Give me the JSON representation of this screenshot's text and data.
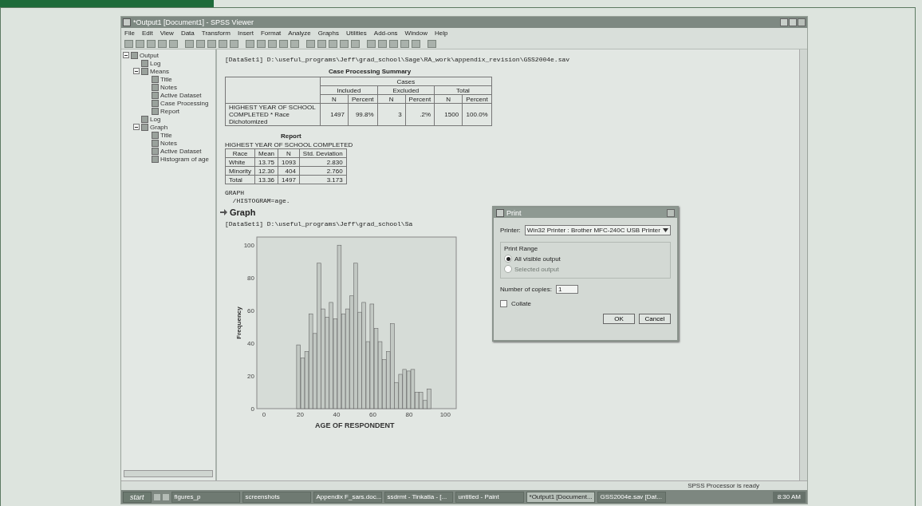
{
  "window": {
    "title": "*Output1 [Document1] - SPSS Viewer"
  },
  "menu": [
    "File",
    "Edit",
    "View",
    "Data",
    "Transform",
    "Insert",
    "Format",
    "Analyze",
    "Graphs",
    "Utilities",
    "Add-ons",
    "Window",
    "Help"
  ],
  "tree": [
    {
      "label": "Output",
      "expanded": true,
      "children": [
        {
          "label": "Log"
        },
        {
          "label": "Means",
          "expanded": true,
          "children": [
            {
              "label": "Title"
            },
            {
              "label": "Notes"
            },
            {
              "label": "Active Dataset"
            },
            {
              "label": "Case Processing"
            },
            {
              "label": "Report"
            }
          ]
        },
        {
          "label": "Log"
        },
        {
          "label": "Graph",
          "expanded": true,
          "children": [
            {
              "label": "Title"
            },
            {
              "label": "Notes"
            },
            {
              "label": "Active Dataset"
            },
            {
              "label": "Histogram of age"
            }
          ]
        }
      ]
    }
  ],
  "output": {
    "path_1": "[DataSet1] D:\\useful_programs\\Jeff\\grad_school\\Sage\\RA_work\\appendix_revision\\GSS2004e.sav",
    "case_summary": {
      "title": "Case Processing Summary",
      "group": "Cases",
      "subgroups": [
        "Included",
        "Excluded",
        "Total"
      ],
      "columns": [
        "N",
        "Percent",
        "N",
        "Percent",
        "N",
        "Percent"
      ],
      "row_label": "HIGHEST YEAR OF SCHOOL COMPLETED * Race Dichotomized",
      "values": [
        "1497",
        "99.8%",
        "3",
        ".2%",
        "1500",
        "100.0%"
      ]
    },
    "report": {
      "title": "Report",
      "subtitle": "HIGHEST YEAR OF SCHOOL COMPLETED",
      "columns": [
        "Race",
        "Mean",
        "N",
        "Std. Deviation"
      ],
      "rows": [
        [
          "White",
          "13.75",
          "1093",
          "2.830"
        ],
        [
          "Minority",
          "12.30",
          "404",
          "2.760"
        ],
        [
          "Total",
          "13.36",
          "1497",
          "3.173"
        ]
      ]
    },
    "syntax": [
      "GRAPH",
      "  /HISTOGRAM=age."
    ],
    "heading": "Graph",
    "path_2": "[DataSet1] D:\\useful_programs\\Jeff\\grad_school\\Sa",
    "chart_data": {
      "type": "bar",
      "xlabel": "AGE OF RESPONDENT",
      "ylabel": "Frequency",
      "x": [
        19,
        21.3,
        23.5,
        25.8,
        28,
        30.3,
        32.5,
        34.8,
        37,
        39.3,
        41.5,
        43.8,
        46,
        48.3,
        50.5,
        52.8,
        55,
        57.3,
        59.5,
        61.8,
        64,
        66.3,
        68.5,
        70.8,
        73,
        75.3,
        77.5,
        79.8,
        82,
        84.3,
        86.5,
        88.8,
        91
      ],
      "values": [
        39,
        31,
        35,
        58,
        46,
        89,
        61,
        56,
        65,
        55,
        100,
        58,
        61,
        69,
        89,
        59,
        65,
        41,
        64,
        49,
        41,
        30,
        35,
        52,
        16,
        21,
        24,
        23,
        24,
        10,
        10,
        5,
        12
      ],
      "xlim": [
        -4,
        106
      ],
      "ylim": [
        0,
        105
      ],
      "xticks": [
        0,
        20,
        40,
        60,
        80,
        100
      ],
      "yticks": [
        0,
        20,
        40,
        60,
        80,
        100
      ]
    }
  },
  "dialog": {
    "title": "Print",
    "printer_label": "Printer:",
    "printer": "Win32 Printer : Brother MFC-240C USB Printer",
    "range_label": "Print Range",
    "options": [
      {
        "label": "All visible output",
        "selected": true,
        "disabled": false
      },
      {
        "label": "Selected output",
        "selected": false,
        "disabled": true
      }
    ],
    "copies_label": "Number of copies:",
    "copies": "1",
    "collate": {
      "label": "Collate",
      "checked": false
    },
    "buttons": [
      "OK",
      "Cancel"
    ]
  },
  "status_bar": "SPSS Processor is ready",
  "taskbar": {
    "start": "start",
    "items": [
      {
        "label": "figures_p",
        "selected": false
      },
      {
        "label": "screenshots",
        "selected": false
      },
      {
        "label": "Appendix F_sars.doc...",
        "selected": false
      },
      {
        "label": "ssdrmt - Tinkatia - [...",
        "selected": false
      },
      {
        "label": "untitled - Paint",
        "selected": false
      },
      {
        "label": "*Output1 [Document...",
        "selected": true
      },
      {
        "label": "GSS2004e.sav [Dat...",
        "selected": false
      }
    ],
    "clock": "8:30 AM"
  }
}
